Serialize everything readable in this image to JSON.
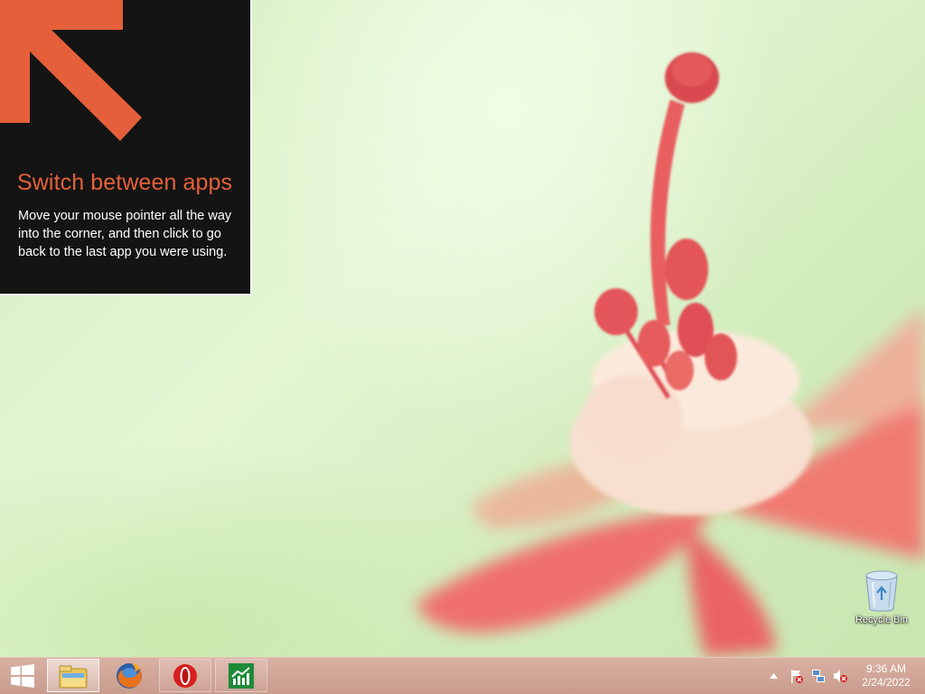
{
  "tip": {
    "title": "Switch between apps",
    "body": "Move your mouse pointer all the way into the corner, and then click to go back to the last app you were using.",
    "accent_color": "#e5603a"
  },
  "desktop": {
    "icons": [
      {
        "label": "Recycle Bin",
        "icon": "recycle-bin-icon"
      }
    ]
  },
  "taskbar": {
    "start_icon": "windows-logo-icon",
    "apps": [
      {
        "name": "File Explorer",
        "icon": "file-explorer-icon",
        "active": true
      },
      {
        "name": "Firefox",
        "icon": "firefox-icon",
        "active": false
      },
      {
        "name": "Opera",
        "icon": "opera-icon",
        "active": false
      },
      {
        "name": "Stock chart app",
        "icon": "chart-app-icon",
        "active": false
      }
    ],
    "tray": {
      "icons": [
        "show-hidden-icons-icon",
        "action-center-flag-icon",
        "network-icon",
        "volume-muted-icon"
      ],
      "time": "9:36 AM",
      "date": "2/24/2022"
    }
  }
}
